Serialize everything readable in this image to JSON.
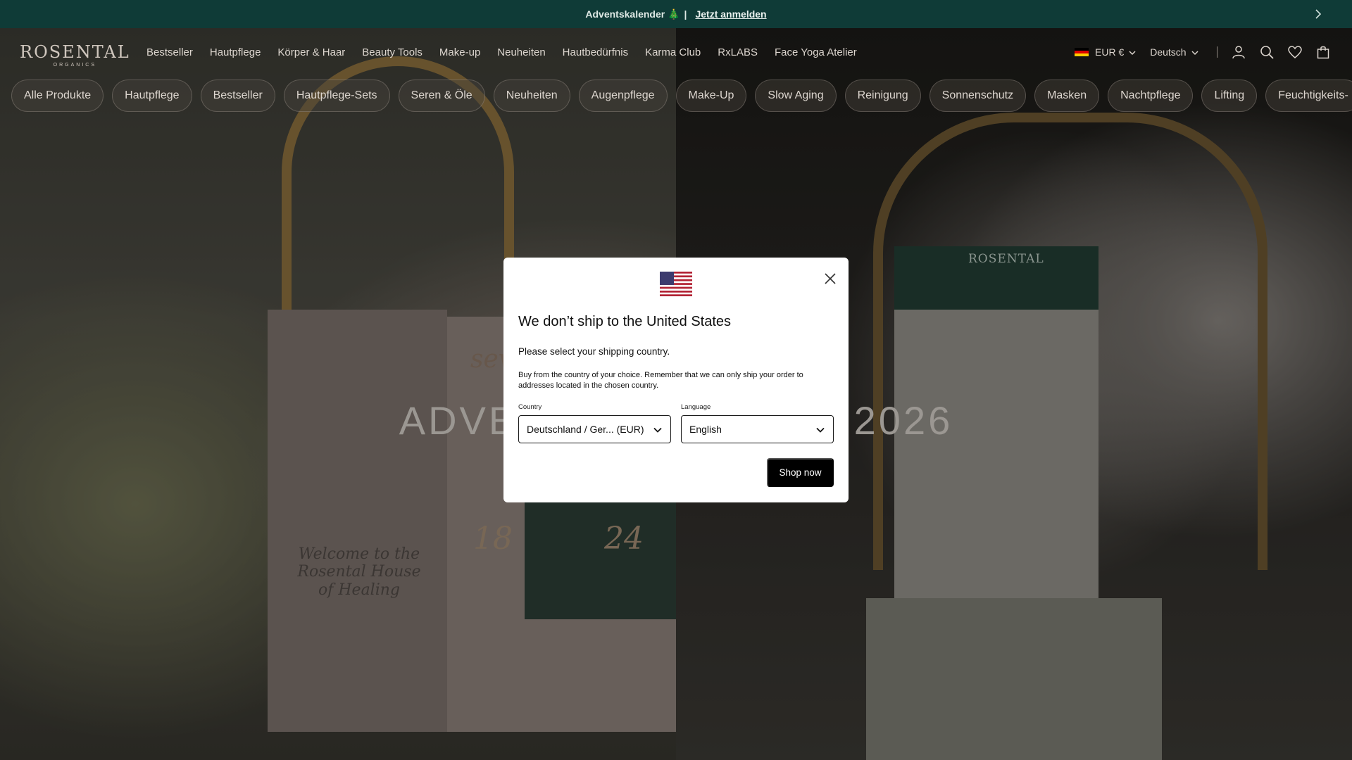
{
  "announcement": {
    "text": "Adventskalender 🎄",
    "separator": "|",
    "link": "Jetzt anmelden",
    "next_icon": "chevron-right-icon"
  },
  "header": {
    "logo": "ROSENTAL",
    "logo_sub": "ORGANICS",
    "nav": [
      "Bestseller",
      "Hautpflege",
      "Körper & Haar",
      "Beauty Tools",
      "Make-up",
      "Neuheiten",
      "Hautbedürfnis",
      "Karma Club",
      "RxLABS",
      "Face Yoga Atelier"
    ],
    "currency": "EUR €",
    "language": "Deutsch",
    "icons": [
      "account-icon",
      "search-icon",
      "heart-icon",
      "bag-icon"
    ]
  },
  "categories": [
    "Alle Produkte",
    "Hautpflege",
    "Bestseller",
    "Hautpflege-Sets",
    "Seren & Öle",
    "Neuheiten",
    "Augenpflege",
    "Make-Up",
    "Slow Aging",
    "Reinigung",
    "Sonnenschutz",
    "Masken",
    "Nachtpflege",
    "Lifting",
    "Feuchtigkeits-"
  ],
  "hero": {
    "title": "ADVENTSKALENDER 2026",
    "welcome": "Welcome to the Rosental House of Healing",
    "box_numbers": [
      "18",
      "24"
    ],
    "box_word": "seve",
    "calendar_brand": "ROSENTAL"
  },
  "modal": {
    "title": "We don’t ship to the United States",
    "subtitle": "Please select your shipping country.",
    "body": "Buy from the country of your choice. Remember that we can only ship your order to addresses located in the chosen country.",
    "country_label": "Country",
    "country_value": "Deutschland / Ger... (EUR)",
    "language_label": "Language",
    "language_value": "English",
    "button": "Shop now"
  }
}
